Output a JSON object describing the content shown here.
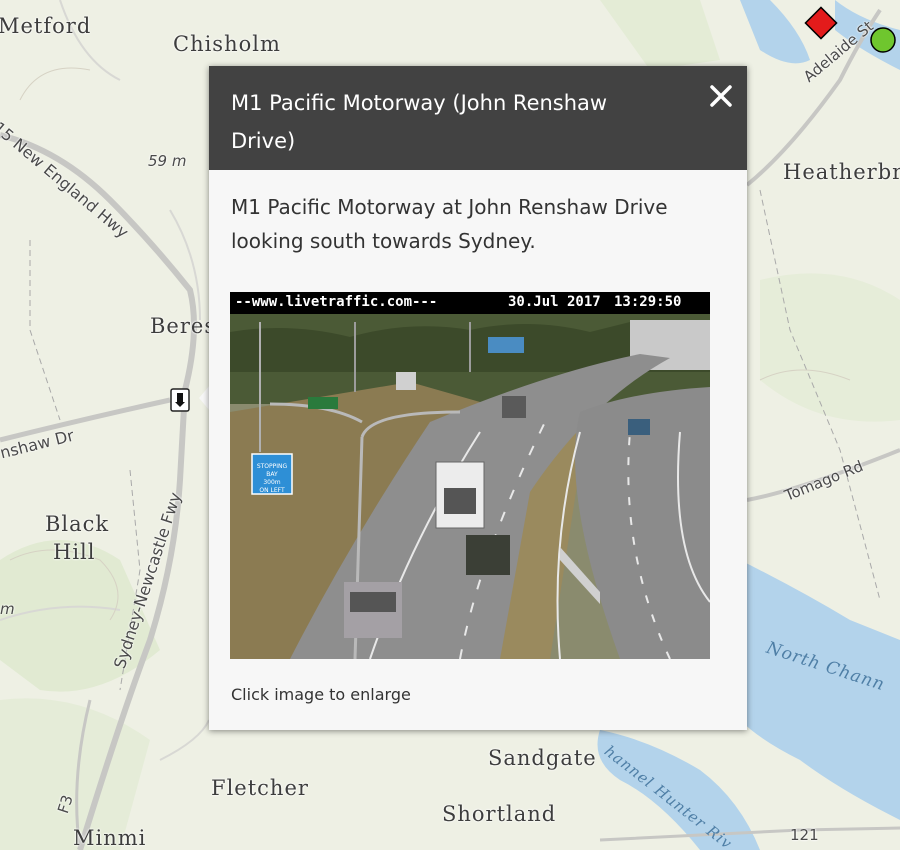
{
  "map": {
    "labels": {
      "metford": "Metford",
      "chisholm": "Chisholm",
      "heatherbrae": "Heatherbra",
      "beresfield": "Beres",
      "black": "Black",
      "hill": "Hill",
      "minmi": "Minmi",
      "fletcher": "Fletcher",
      "sandgate": "Sandgate",
      "shortland": "Shortland"
    },
    "roads": {
      "new_england_hwy": "15 New England Hwy",
      "renshaw_dr": "nshaw Dr",
      "newcastle_fwy": "Sydney-Newcastle Fwy",
      "tomago_rd": "Tomago Rd",
      "adelaide_st": "Adelaide St",
      "f3": "F3",
      "route_121": "121"
    },
    "elevations": {
      "e59": "59 m",
      "e_left": "m"
    },
    "water": {
      "north_channel": "North Chann",
      "hunter_river": "hannel Hunter Riv"
    },
    "colors": {
      "land": "#eef0e4",
      "water": "#b3d3eb",
      "road": "#c7c7c4",
      "marker_red": "#e31b1b",
      "marker_green": "#6fc62e"
    }
  },
  "popup": {
    "title": "M1 Pacific Motorway (John Renshaw Drive)",
    "description": "M1 Pacific Motorway at John Renshaw Drive looking south towards Sydney.",
    "camera": {
      "url_text": "--www.livetraffic.com---",
      "date_text": "30.Jul 2017",
      "time_text": "13:29:50",
      "sign_text": "STOPPING BAY 300m ON LEFT"
    },
    "footer": "Click image to enlarge",
    "close_icon": "close-icon",
    "header_color": "#424242"
  }
}
